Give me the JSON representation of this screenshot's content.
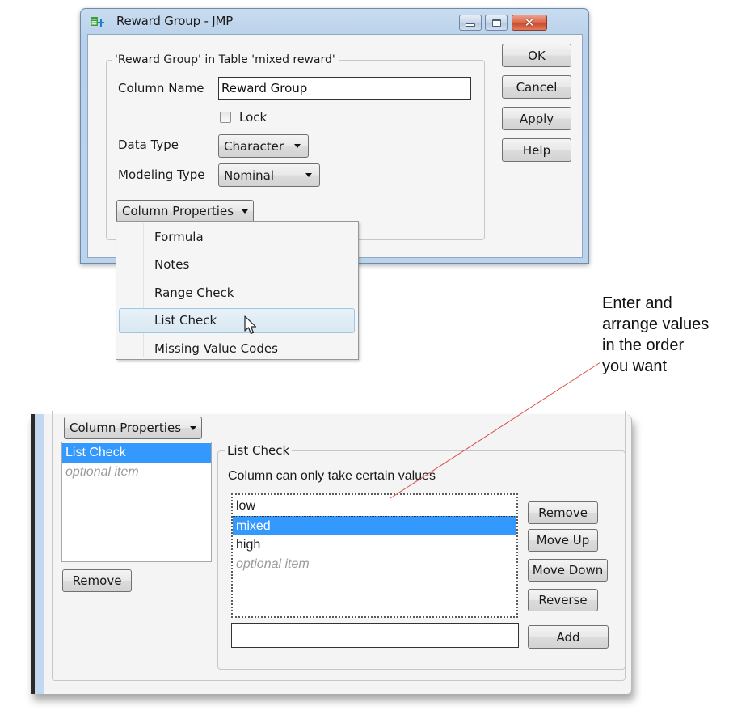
{
  "dialog": {
    "title": "Reward Group - JMP",
    "window_controls": [
      "minimize-icon",
      "maximize-icon",
      "close-icon"
    ],
    "group_title": "'Reward Group' in Table 'mixed reward'",
    "column_name_label": "Column Name",
    "column_name_value": "Reward Group",
    "lock_label": "Lock",
    "lock_checked": false,
    "data_type_label": "Data Type",
    "data_type_value": "Character",
    "modeling_type_label": "Modeling Type",
    "modeling_type_value": "Nominal",
    "column_properties_label": "Column Properties",
    "buttons": {
      "ok": "OK",
      "cancel": "Cancel",
      "apply": "Apply",
      "help": "Help"
    }
  },
  "menu": {
    "items": [
      {
        "label": "Formula"
      },
      {
        "label": "Notes"
      },
      {
        "label": "Range Check"
      },
      {
        "label": "List Check",
        "highlighted": true
      },
      {
        "label": "Missing Value Codes"
      }
    ]
  },
  "callout": {
    "lines": [
      "Enter and",
      "arrange values",
      "in the order",
      "you want"
    ],
    "line_color": "#d9534f"
  },
  "panel": {
    "column_properties_label": "Column Properties",
    "property_list": [
      {
        "label": "List Check",
        "selected": true
      },
      {
        "label": "optional item",
        "placeholder": true
      }
    ],
    "remove_label": "Remove",
    "list_check": {
      "group_title": "List Check",
      "description": "Column can only take certain values",
      "values": [
        {
          "label": "low"
        },
        {
          "label": "mixed",
          "selected": true
        },
        {
          "label": "high"
        },
        {
          "label": "optional item",
          "placeholder": true
        }
      ],
      "buttons": {
        "remove": "Remove",
        "move_up": "Move Up",
        "move_down": "Move Down",
        "reverse": "Reverse",
        "add": "Add"
      },
      "new_value": ""
    }
  },
  "colors": {
    "selection": "#3399ff",
    "titlebar": "#b8d0ea",
    "close_button": "#d9664a"
  }
}
